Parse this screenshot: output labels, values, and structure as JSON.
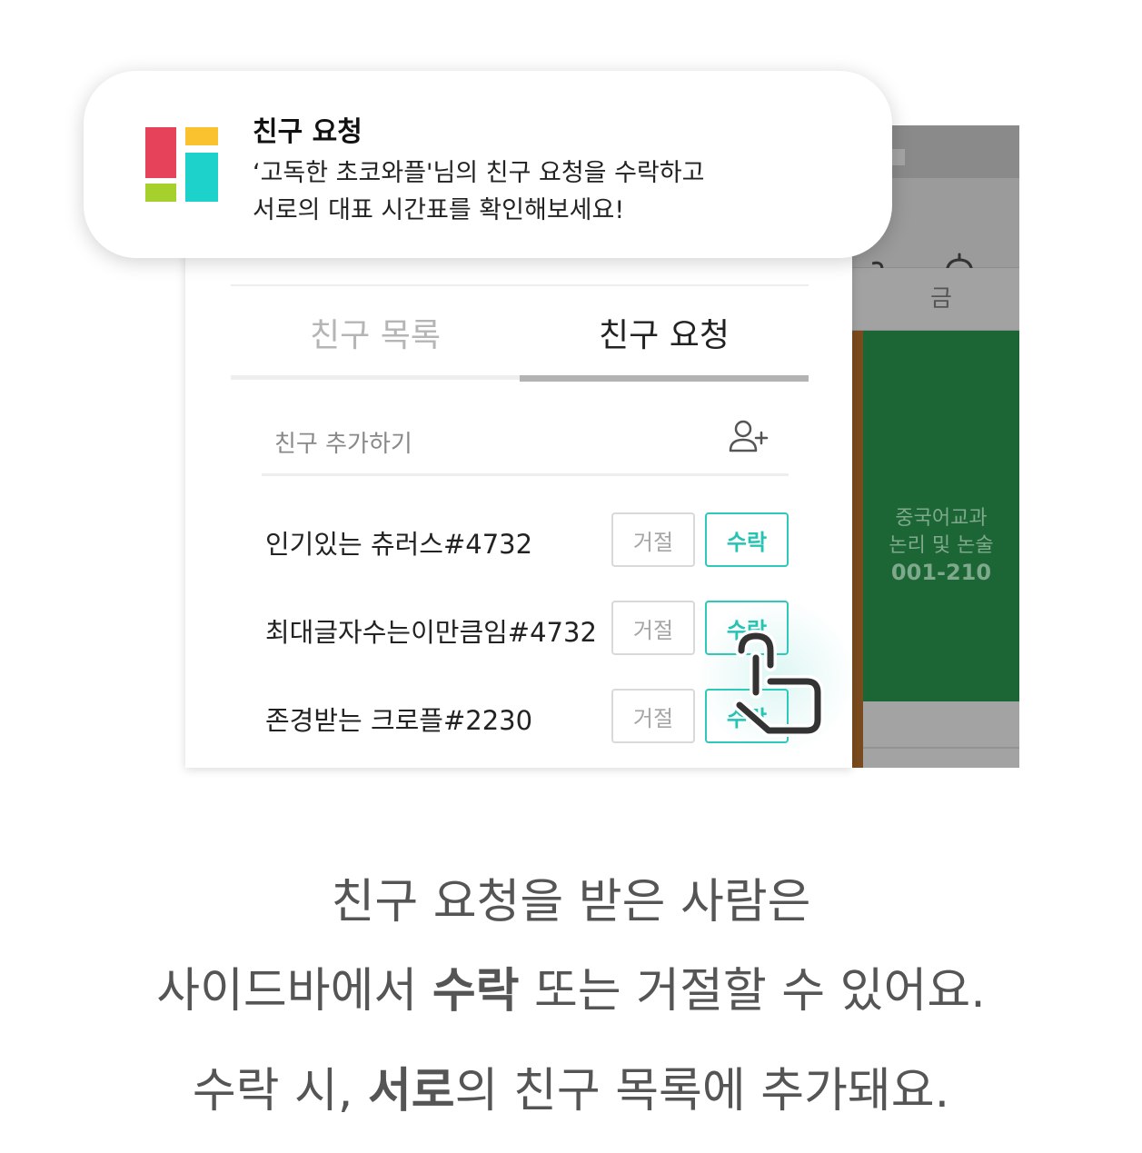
{
  "colors": {
    "accent_teal": "#2ec9b8",
    "timetable_green": "#1c6535",
    "timetable_brown": "#7a4b1e",
    "logo_red": "#e6425a",
    "logo_yellow": "#f9c22e",
    "logo_green": "#a6d12c",
    "logo_cyan": "#1ed2cc"
  },
  "notification": {
    "icon": "app-logo-icon",
    "title": "친구 요청",
    "line1": "‘고독한 초코와플'님의 친구 요청을 수락하고",
    "line2": "서로의 대표 시간표를 확인해보세요!"
  },
  "background_app": {
    "icons": [
      "partial-icon",
      "bell-icon"
    ],
    "day_label": "금",
    "course_line1": "중국어교과",
    "course_line2": "논리 및 논술",
    "course_room": "001-210"
  },
  "sidebar": {
    "tabs": [
      {
        "label": "친구 목록",
        "active": false
      },
      {
        "label": "친구 요청",
        "active": true
      }
    ],
    "add_friend": {
      "label": "친구 추가하기",
      "icon": "add-user-icon"
    },
    "requests": [
      {
        "name": "인기있는 츄러스#4732",
        "reject_label": "거절",
        "accept_label": "수락"
      },
      {
        "name": "최대글자수는이만큼임#4732",
        "reject_label": "거절",
        "accept_label": "수락"
      },
      {
        "name": "존경받는 크로플#2230",
        "reject_label": "거절",
        "accept_label": "수락"
      }
    ],
    "pointer_icon": "tap-hand-icon"
  },
  "caption": {
    "line1": "친구 요청을 받은 사람은",
    "line2_pre": "사이드바에서 ",
    "line2_bold": "수락",
    "line2_post": " 또는 거절할 수 있어요.",
    "line3_pre": "수락 시, ",
    "line3_bold": "서로",
    "line3_post": "의 친구 목록에 추가돼요."
  }
}
